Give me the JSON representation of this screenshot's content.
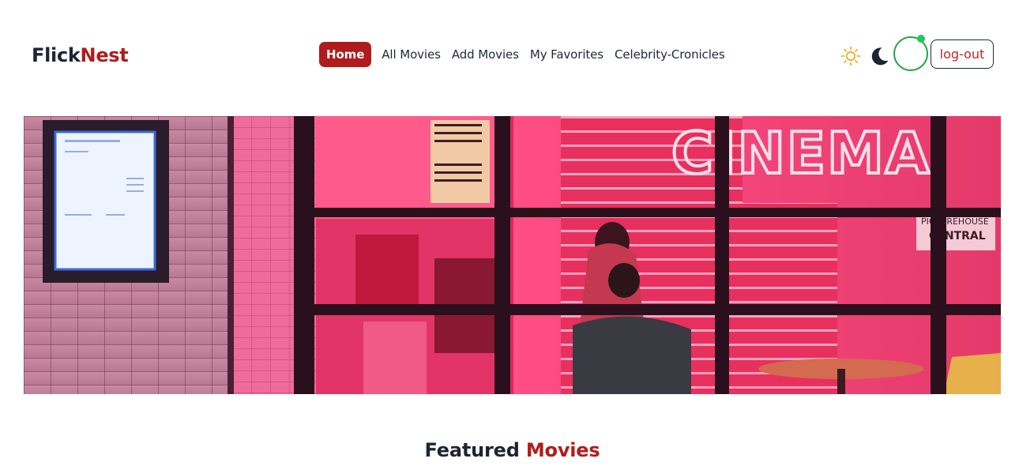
{
  "brand": {
    "part1": "Flick",
    "part2": "Nest"
  },
  "nav": {
    "links": [
      {
        "label": "Home",
        "active": true
      },
      {
        "label": "All Movies"
      },
      {
        "label": "Add Movies"
      },
      {
        "label": "My Favorites"
      },
      {
        "label": "Celebrity-Cronicles"
      }
    ]
  },
  "actions": {
    "light_theme_icon": "sun-icon",
    "dark_theme_icon": "moon-icon",
    "logout_label": "log-out"
  },
  "hero": {
    "sign_text": "CINEMA",
    "secondary_sign_1": "PICTUREHOUSE",
    "secondary_sign_2": "CENTRAL"
  },
  "featured": {
    "word1": "Featured",
    "word2": "Movies"
  },
  "colors": {
    "brand_dark": "#1e2433",
    "brand_red": "#b01c1c",
    "status_green": "#22a34a"
  }
}
